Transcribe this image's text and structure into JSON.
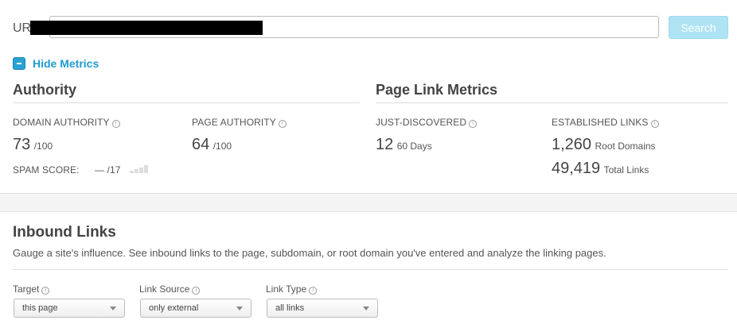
{
  "url_bar": {
    "label": "UR",
    "value": "",
    "search_label": "Search"
  },
  "toggle": {
    "label": "Hide Metrics"
  },
  "authority": {
    "title": "Authority",
    "domain_label": "DOMAIN AUTHORITY",
    "domain_value": "73",
    "domain_max": "/100",
    "page_label": "PAGE AUTHORITY",
    "page_value": "64",
    "page_max": "/100",
    "spam_label": "SPAM SCORE:",
    "spam_value": "— /17"
  },
  "page_link_metrics": {
    "title": "Page Link Metrics",
    "just_label": "JUST-DISCOVERED",
    "just_value": "12",
    "just_unit": "60 Days",
    "est_label": "ESTABLISHED LINKS",
    "root_value": "1,260",
    "root_unit": "Root Domains",
    "total_value": "49,419",
    "total_unit": "Total Links"
  },
  "inbound": {
    "title": "Inbound Links",
    "description": "Gauge a site's influence. See inbound links to the page, subdomain, or root domain you've entered and analyze the linking pages.",
    "filters": [
      {
        "label": "Target",
        "value": "this page"
      },
      {
        "label": "Link Source",
        "value": "only external"
      },
      {
        "label": "Link Type",
        "value": "all links"
      }
    ]
  },
  "icons": {
    "info": "info-icon",
    "toggle": "minus-box-icon",
    "dropdown": "chevron-down-icon"
  },
  "colors": {
    "accent": "#1f9bd0",
    "search_button": "#aee3f4"
  }
}
